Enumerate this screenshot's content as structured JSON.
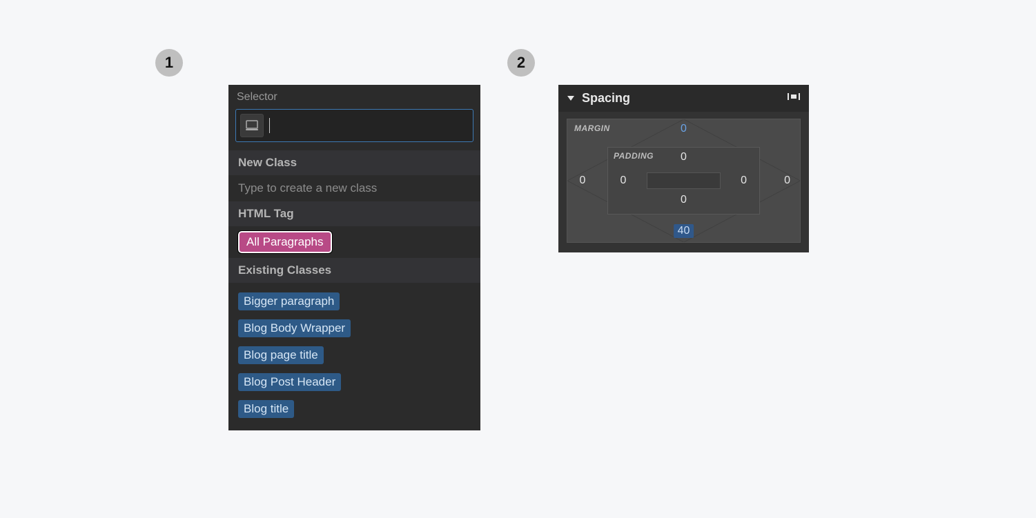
{
  "steps": {
    "one": "1",
    "two": "2"
  },
  "selector_panel": {
    "header": "Selector",
    "new_class_header": "New Class",
    "new_class_placeholder": "Type to create a new class",
    "html_tag_header": "HTML Tag",
    "html_tag_chip": "All Paragraphs",
    "existing_header": "Existing Classes",
    "existing": [
      "Bigger paragraph",
      "Blog Body Wrapper",
      "Blog page title",
      "Blog Post Header",
      "Blog title"
    ]
  },
  "spacing_panel": {
    "title": "Spacing",
    "margin_label": "MARGIN",
    "padding_label": "PADDING",
    "margin": {
      "top": "0",
      "right": "0",
      "bottom": "40",
      "left": "0"
    },
    "padding": {
      "top": "0",
      "right": "0",
      "bottom": "0",
      "left": "0"
    }
  }
}
